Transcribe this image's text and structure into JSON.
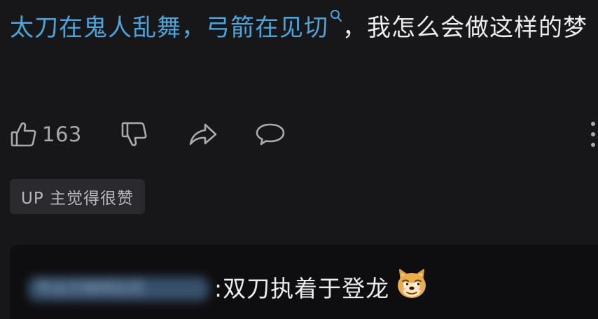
{
  "comment": {
    "link_text": "太刀在鬼人乱舞，弓箭在见切",
    "body_text": "，我怎么会做这样的梦"
  },
  "actions": {
    "like_count": "163",
    "icons": [
      "thumbs-up-icon",
      "thumbs-down-icon",
      "share-icon",
      "comment-icon",
      "more-icon"
    ]
  },
  "badge": {
    "label": "UP 主觉得很赞"
  },
  "reply": {
    "author_name": "专业方咖啡拉花",
    "separator": ":",
    "text": " 双刀执着于登龙",
    "emoji": "doge-emoji"
  },
  "colors": {
    "background": "#17171a",
    "link": "#4fa3d9",
    "text": "#ececee",
    "muted": "#a9a9ae",
    "badge_bg": "#2a2a2e",
    "reply_bg": "#0e0e10"
  }
}
